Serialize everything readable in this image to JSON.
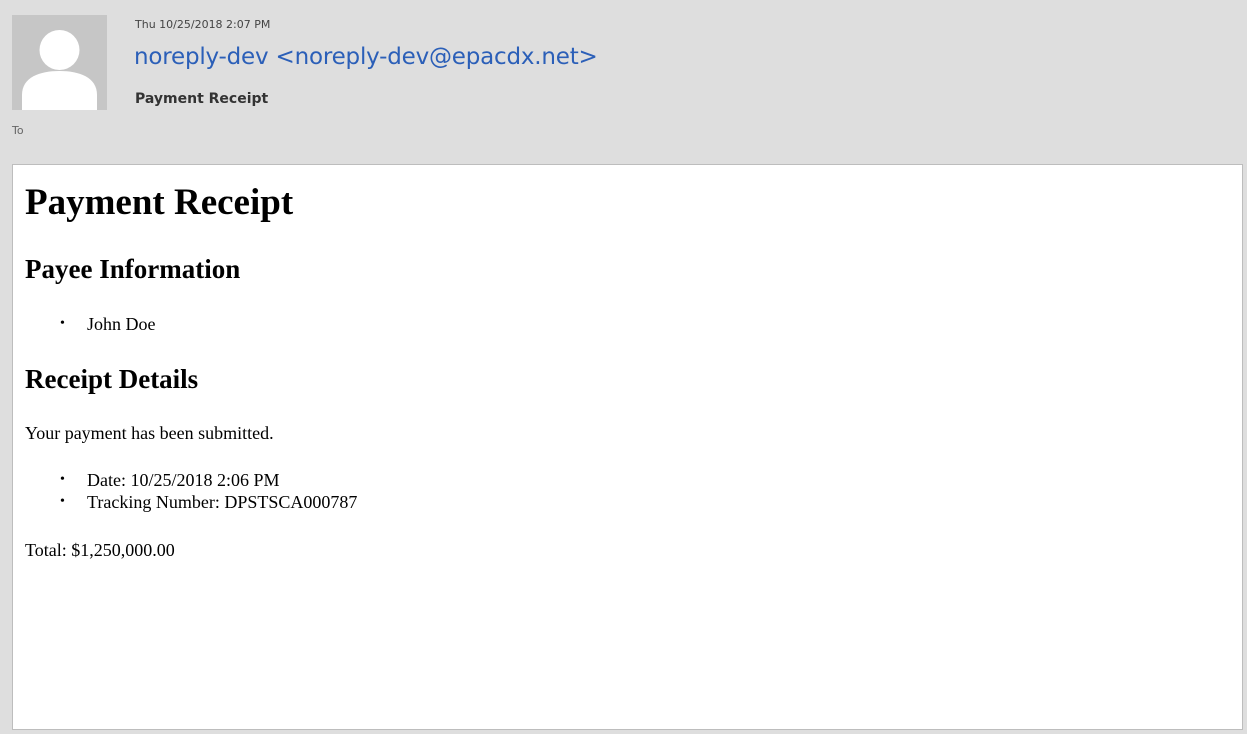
{
  "header": {
    "timestamp": "Thu 10/25/2018 2:07 PM",
    "sender": "noreply-dev <noreply-dev@epacdx.net>",
    "subject": "Payment Receipt",
    "to_label": "To",
    "avatar_icon": "person-placeholder-icon"
  },
  "message": {
    "title": "Payment Receipt",
    "payee_heading": "Payee Information",
    "payee_items": [
      "John Doe"
    ],
    "details_heading": "Receipt Details",
    "intro": "Your payment has been submitted.",
    "details_items": [
      "Date: 10/25/2018 2:06 PM",
      "Tracking Number: DPSTSCA000787"
    ],
    "total": "Total: $1,250,000.00",
    "bullet_char": "•"
  },
  "colors": {
    "header_bg": "#dedede",
    "sender_link": "#2b5fb8",
    "body_bg": "#ffffff"
  }
}
